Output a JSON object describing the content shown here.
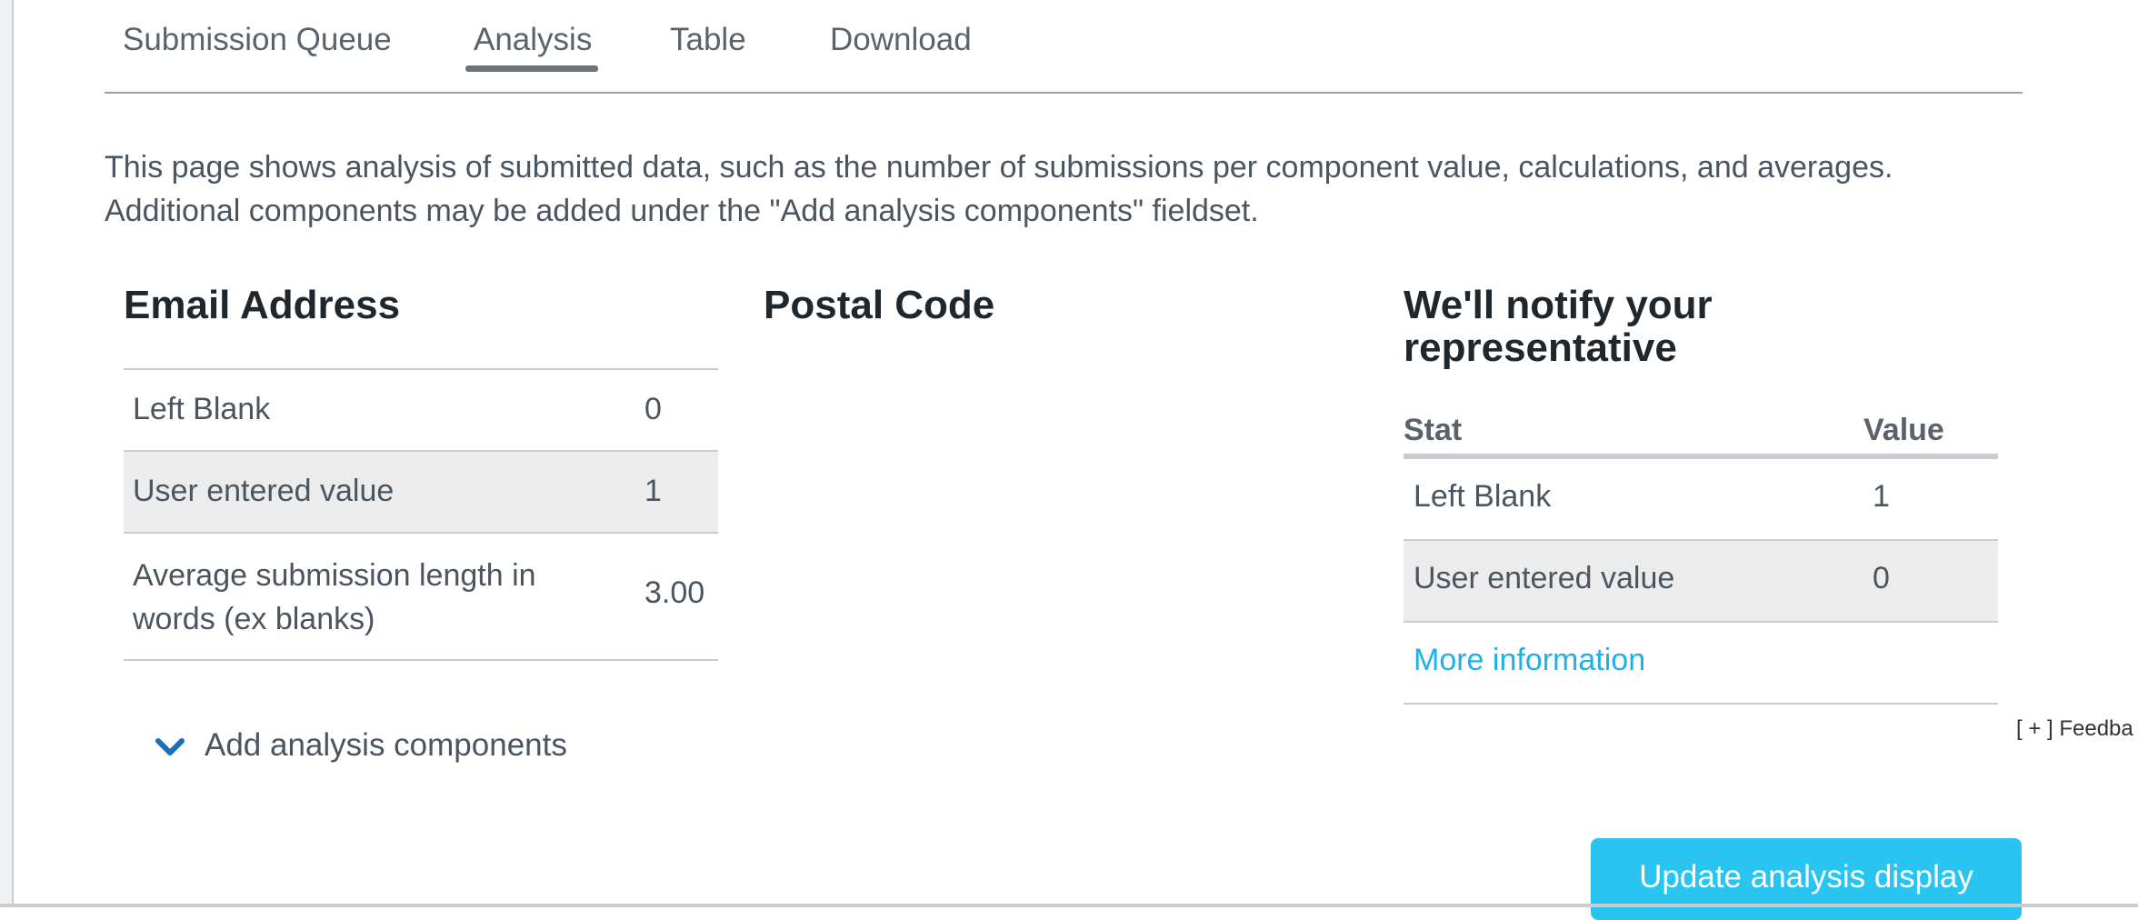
{
  "tabs": [
    {
      "label": "Submission Queue"
    },
    {
      "label": "Analysis",
      "active": true
    },
    {
      "label": "Table"
    },
    {
      "label": "Download"
    }
  ],
  "intro": {
    "line1": "This page shows analysis of submitted data, such as the number of submissions per component value, calculations, and averages.",
    "line2": "Additional components may be added under the \"Add analysis components\" fieldset."
  },
  "email": {
    "title": "Email Address",
    "rows": [
      {
        "label": "Left Blank",
        "value": "0"
      },
      {
        "label": "User entered value",
        "value": "1"
      },
      {
        "label_line1": "Average submission length in",
        "label_line2": "words (ex blanks)",
        "value": "3.00"
      }
    ]
  },
  "postal": {
    "title": "Postal Code"
  },
  "notify": {
    "title_line1": "We'll notify your",
    "title_line2": "representative",
    "headers": {
      "stat": "Stat",
      "value": "Value"
    },
    "rows": [
      {
        "label": "Left Blank",
        "value": "1"
      },
      {
        "label": "User entered value",
        "value": "0"
      }
    ],
    "more_link": "More information"
  },
  "add_components": {
    "label": "Add analysis components",
    "icon": "chevron-down-icon"
  },
  "feedback": "[ + ] Feedba",
  "update_button": "Update analysis display",
  "colors": {
    "accent": "#29c4ef",
    "link": "#1fb0e6",
    "chevron": "#1d6fb5",
    "row_alt": "#ececec"
  }
}
